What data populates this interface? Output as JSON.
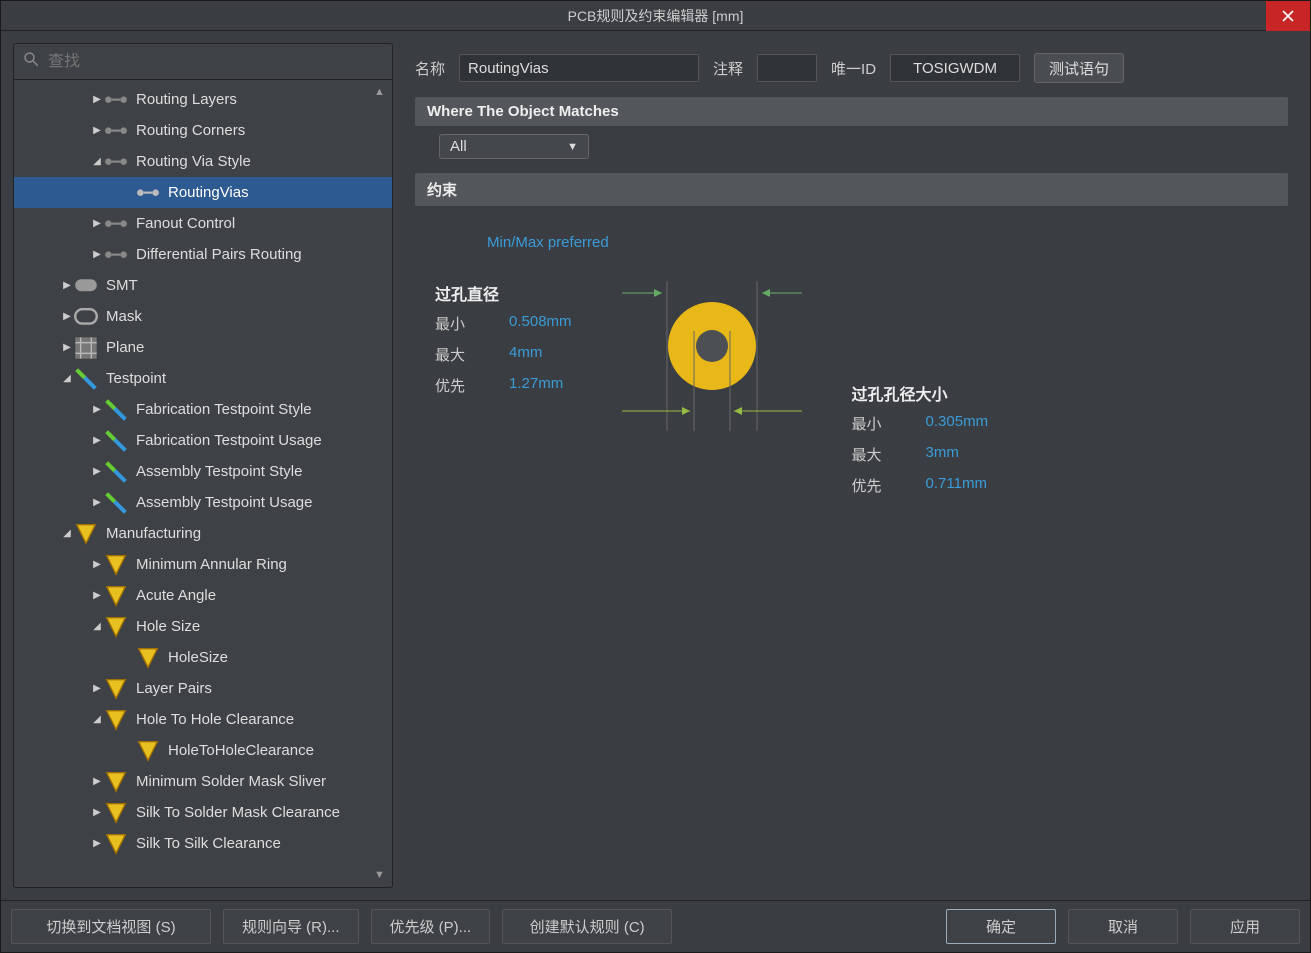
{
  "title": "PCB规则及约束编辑器 [mm]",
  "search_placeholder": "查找",
  "tree": {
    "routing_layers": "Routing Layers",
    "routing_corners": "Routing Corners",
    "routing_via_style": "Routing Via Style",
    "routing_vias": "RoutingVias",
    "fanout_control": "Fanout Control",
    "diff_pairs": "Differential Pairs Routing",
    "smt": "SMT",
    "mask": "Mask",
    "plane": "Plane",
    "testpoint": "Testpoint",
    "fab_tp_style": "Fabrication Testpoint Style",
    "fab_tp_usage": "Fabrication Testpoint Usage",
    "asm_tp_style": "Assembly Testpoint Style",
    "asm_tp_usage": "Assembly Testpoint Usage",
    "manufacturing": "Manufacturing",
    "min_annular": "Minimum Annular Ring",
    "acute_angle": "Acute Angle",
    "hole_size": "Hole Size",
    "holesize_rule": "HoleSize",
    "layer_pairs": "Layer Pairs",
    "hole_to_hole": "Hole To Hole Clearance",
    "holetohole_rule": "HoleToHoleClearance",
    "min_solder_sliver": "Minimum Solder Mask Sliver",
    "silk_solder": "Silk To Solder Mask Clearance",
    "silk_silk": "Silk To Silk Clearance"
  },
  "form": {
    "name_label": "名称",
    "name_value": "RoutingVias",
    "comment_label": "注释",
    "comment_value": "",
    "id_label": "唯一ID",
    "id_value": "TOSIGWDM",
    "test_btn": "测试语句"
  },
  "sections": {
    "where": "Where The Object Matches",
    "constraints": "约束"
  },
  "scope_value": "All",
  "minmax_link": "Min/Max preferred",
  "via_diameter": {
    "title": "过孔直径",
    "min_label": "最小",
    "min_value": "0.508mm",
    "max_label": "最大",
    "max_value": "4mm",
    "pref_label": "优先",
    "pref_value": "1.27mm"
  },
  "hole_size": {
    "title": "过孔孔径大小",
    "min_label": "最小",
    "min_value": "0.305mm",
    "max_label": "最大",
    "max_value": "3mm",
    "pref_label": "优先",
    "pref_value": "0.711mm"
  },
  "footer": {
    "switch_view": "切换到文档视图 (S)",
    "rule_wizard": "规则向导 (R)...",
    "priorities": "优先级 (P)...",
    "create_default": "创建默认规则 (C)",
    "ok": "确定",
    "cancel": "取消",
    "apply": "应用"
  }
}
